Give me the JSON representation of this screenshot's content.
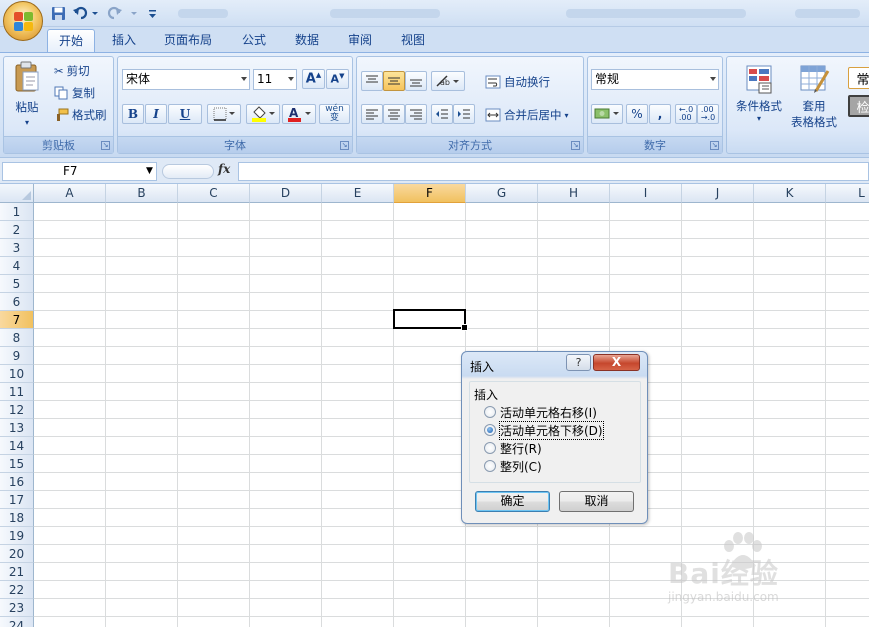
{
  "colors": {
    "accent": "#15428b",
    "selected_header": "#f1c15f",
    "dialog_close": "#c6472d"
  },
  "quick_access": {
    "save_icon": "save-icon",
    "undo_icon": "undo-icon",
    "redo_icon": "redo-icon"
  },
  "tabs": [
    "开始",
    "插入",
    "页面布局",
    "公式",
    "数据",
    "审阅",
    "视图"
  ],
  "ribbon": {
    "clipboard": {
      "paste": "粘贴",
      "cut": "剪切",
      "copy": "复制",
      "format_painter": "格式刷",
      "label": "剪贴板"
    },
    "font": {
      "name": "宋体",
      "size": "11",
      "bold": "B",
      "italic": "I",
      "underline": "U",
      "label": "字体",
      "phonetic": "wén\n变"
    },
    "alignment": {
      "wrap_text": "自动换行",
      "merge_center": "合并后居中",
      "label": "对齐方式"
    },
    "number": {
      "format": "常规",
      "percent": "%",
      "comma": ",",
      "inc_decimal": ".00",
      "label": "数字"
    },
    "styles": {
      "conditional": "条件格式",
      "table_line1": "套用",
      "table_line2": "表格格式",
      "cell_styles": "常",
      "cell_styles2": "检"
    }
  },
  "formula_bar": {
    "name_box": "F7",
    "fx": "fx",
    "formula": ""
  },
  "sheet": {
    "columns": [
      "A",
      "B",
      "C",
      "D",
      "E",
      "F",
      "G",
      "H",
      "I",
      "J",
      "K",
      "L"
    ],
    "rows": [
      "1",
      "2",
      "3",
      "4",
      "5",
      "6",
      "7",
      "8",
      "9",
      "10",
      "11",
      "12",
      "13",
      "14",
      "15",
      "16",
      "17",
      "18",
      "19",
      "20",
      "21",
      "22",
      "23",
      "24"
    ],
    "selected_column": "F",
    "selected_row": "7"
  },
  "dialog": {
    "title": "插入",
    "help": "?",
    "close": "X",
    "group_label": "插入",
    "options": [
      "活动单元格右移(I)",
      "活动单元格下移(D)",
      "整行(R)",
      "整列(C)"
    ],
    "selected_index": 1,
    "ok": "确定",
    "cancel": "取消"
  },
  "watermark": {
    "brand": "Bai经验",
    "url": "jingyan.baidu.com"
  }
}
